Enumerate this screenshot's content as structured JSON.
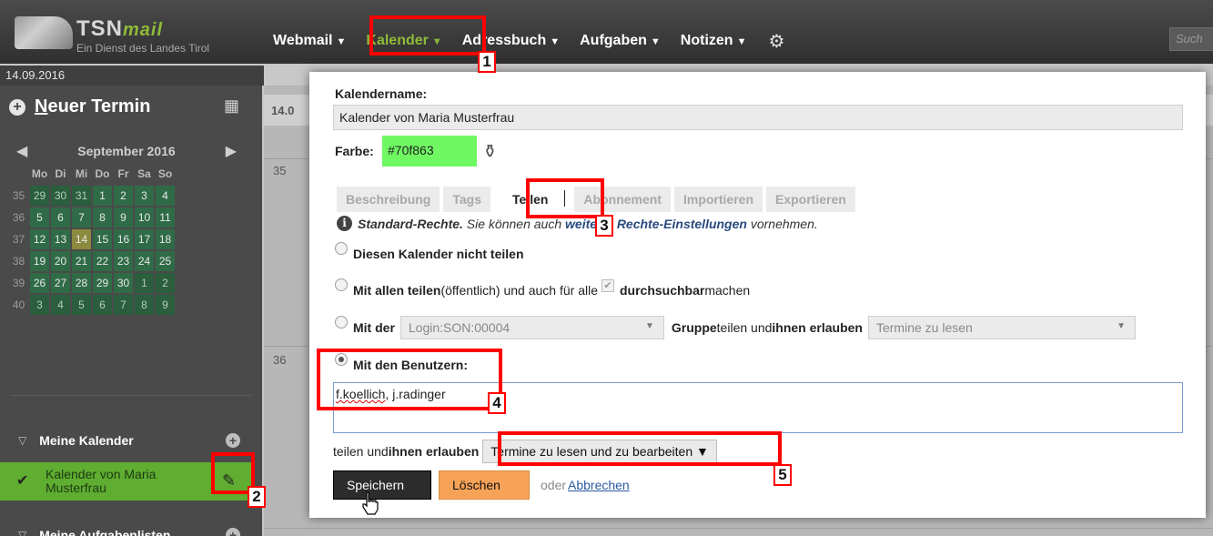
{
  "app": {
    "brand": "TSN",
    "brand_suffix": "mail",
    "subtitle": "Ein Dienst des Landes Tirol"
  },
  "nav": {
    "items": [
      {
        "label": "Webmail"
      },
      {
        "label": "Kalender"
      },
      {
        "label": "Adressbuch"
      },
      {
        "label": "Aufgaben"
      },
      {
        "label": "Notizen"
      }
    ],
    "search_placeholder": "Such"
  },
  "date_strip": "14.09.2016",
  "sidebar": {
    "new_event_first_letter": "N",
    "new_event_rest": "euer Termin",
    "mini_calendar": {
      "month": "September 2016",
      "weekdays": [
        "Mo",
        "Di",
        "Mi",
        "Do",
        "Fr",
        "Sa",
        "So"
      ],
      "weeks": [
        {
          "wk": "35",
          "days": [
            "29",
            "30",
            "31",
            "1",
            "2",
            "3",
            "4"
          ]
        },
        {
          "wk": "36",
          "days": [
            "5",
            "6",
            "7",
            "8",
            "9",
            "10",
            "11"
          ]
        },
        {
          "wk": "37",
          "days": [
            "12",
            "13",
            "14",
            "15",
            "16",
            "17",
            "18"
          ]
        },
        {
          "wk": "38",
          "days": [
            "19",
            "20",
            "21",
            "22",
            "23",
            "24",
            "25"
          ]
        },
        {
          "wk": "39",
          "days": [
            "26",
            "27",
            "28",
            "29",
            "30",
            "1",
            "2"
          ]
        },
        {
          "wk": "40",
          "days": [
            "3",
            "4",
            "5",
            "6",
            "7",
            "8",
            "9"
          ]
        }
      ],
      "today": "14"
    },
    "my_calendars": "Meine Kalender",
    "calendar_entry": "Kalender von Maria Musterfrau",
    "my_tasklists": "Meine Aufgabenlisten"
  },
  "background": {
    "date": "14.0",
    "week_35": "35",
    "week_36": "36"
  },
  "dialog": {
    "calendar_name_label": "Kalendername:",
    "calendar_name_value": "Kalender von Maria Musterfrau",
    "color_label": "Farbe:",
    "color_value": "#70f863",
    "tabs": [
      "Beschreibung",
      "Tags",
      "Teilen",
      "Abonnement",
      "Importieren",
      "Exportieren"
    ],
    "info_bold": "Standard-Rechte.",
    "info_mid": " Sie können auch ",
    "info_link": "weiterte Rechte-Einstellungen",
    "info_end": " vornehmen.",
    "opt_no_share": "Diesen Kalender nicht teilen",
    "opt_all_a": "Mit allen teilen",
    "opt_all_b": " (öffentlich) und auch für alle ",
    "opt_all_c": "durchsuchbar",
    "opt_all_d": " machen",
    "opt_group_a": "Mit der",
    "group_value": "Login:SON:00004",
    "opt_group_b": "Gruppe",
    "opt_group_c": " teilen und ",
    "opt_group_d": "ihnen erlauben",
    "group_perm": "Termine zu lesen",
    "opt_users": "Mit den Benutzern:",
    "users_spell": "f.koellich",
    "users_rest": ", j.radinger",
    "share_a": "teilen und ",
    "share_b": "ihnen erlauben",
    "user_perm": "Termine zu lesen und zu bearbeiten",
    "save": "Speichern",
    "delete": "Löschen",
    "or": "oder",
    "cancel": "Abbrechen"
  },
  "callouts": [
    "1",
    "2",
    "3",
    "4",
    "5"
  ],
  "colors": {
    "accent_green": "#8ebb3a",
    "calendar_green": "#5fad31",
    "callout_red": "#ff0000",
    "delete_orange": "#f6a358"
  }
}
